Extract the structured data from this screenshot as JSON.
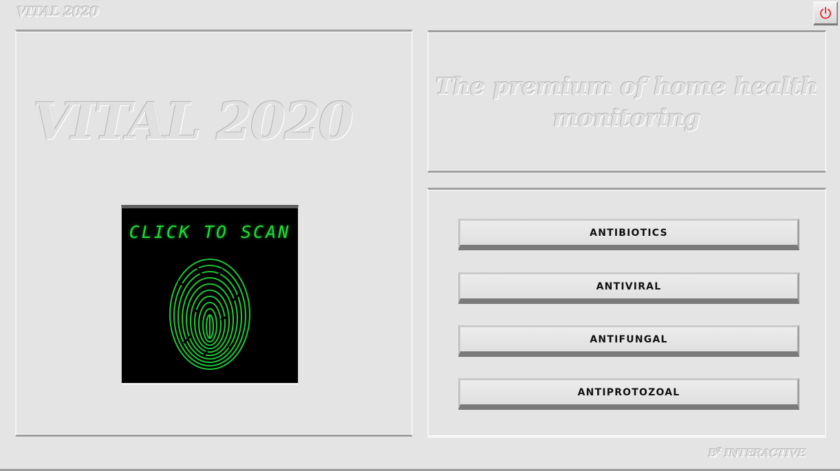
{
  "app": {
    "small_title": "VITAL 2020",
    "big_title": "VITAL 2020",
    "tagline": "The premium of home health monitoring"
  },
  "scanner": {
    "label": "CLICK TO SCAN",
    "icon": "fingerprint-icon",
    "accent_color": "#22d838"
  },
  "categories": [
    {
      "label": "ANTIBIOTICS"
    },
    {
      "label": "ANTIVIRAL"
    },
    {
      "label": "ANTIFUNGAL"
    },
    {
      "label": "ANTIPROTOZOAL"
    }
  ],
  "power": {
    "icon": "power-icon",
    "color": "#e8222a"
  },
  "brand": {
    "prefix": "B",
    "sup": "2",
    "name": "INTERACTIVE"
  }
}
